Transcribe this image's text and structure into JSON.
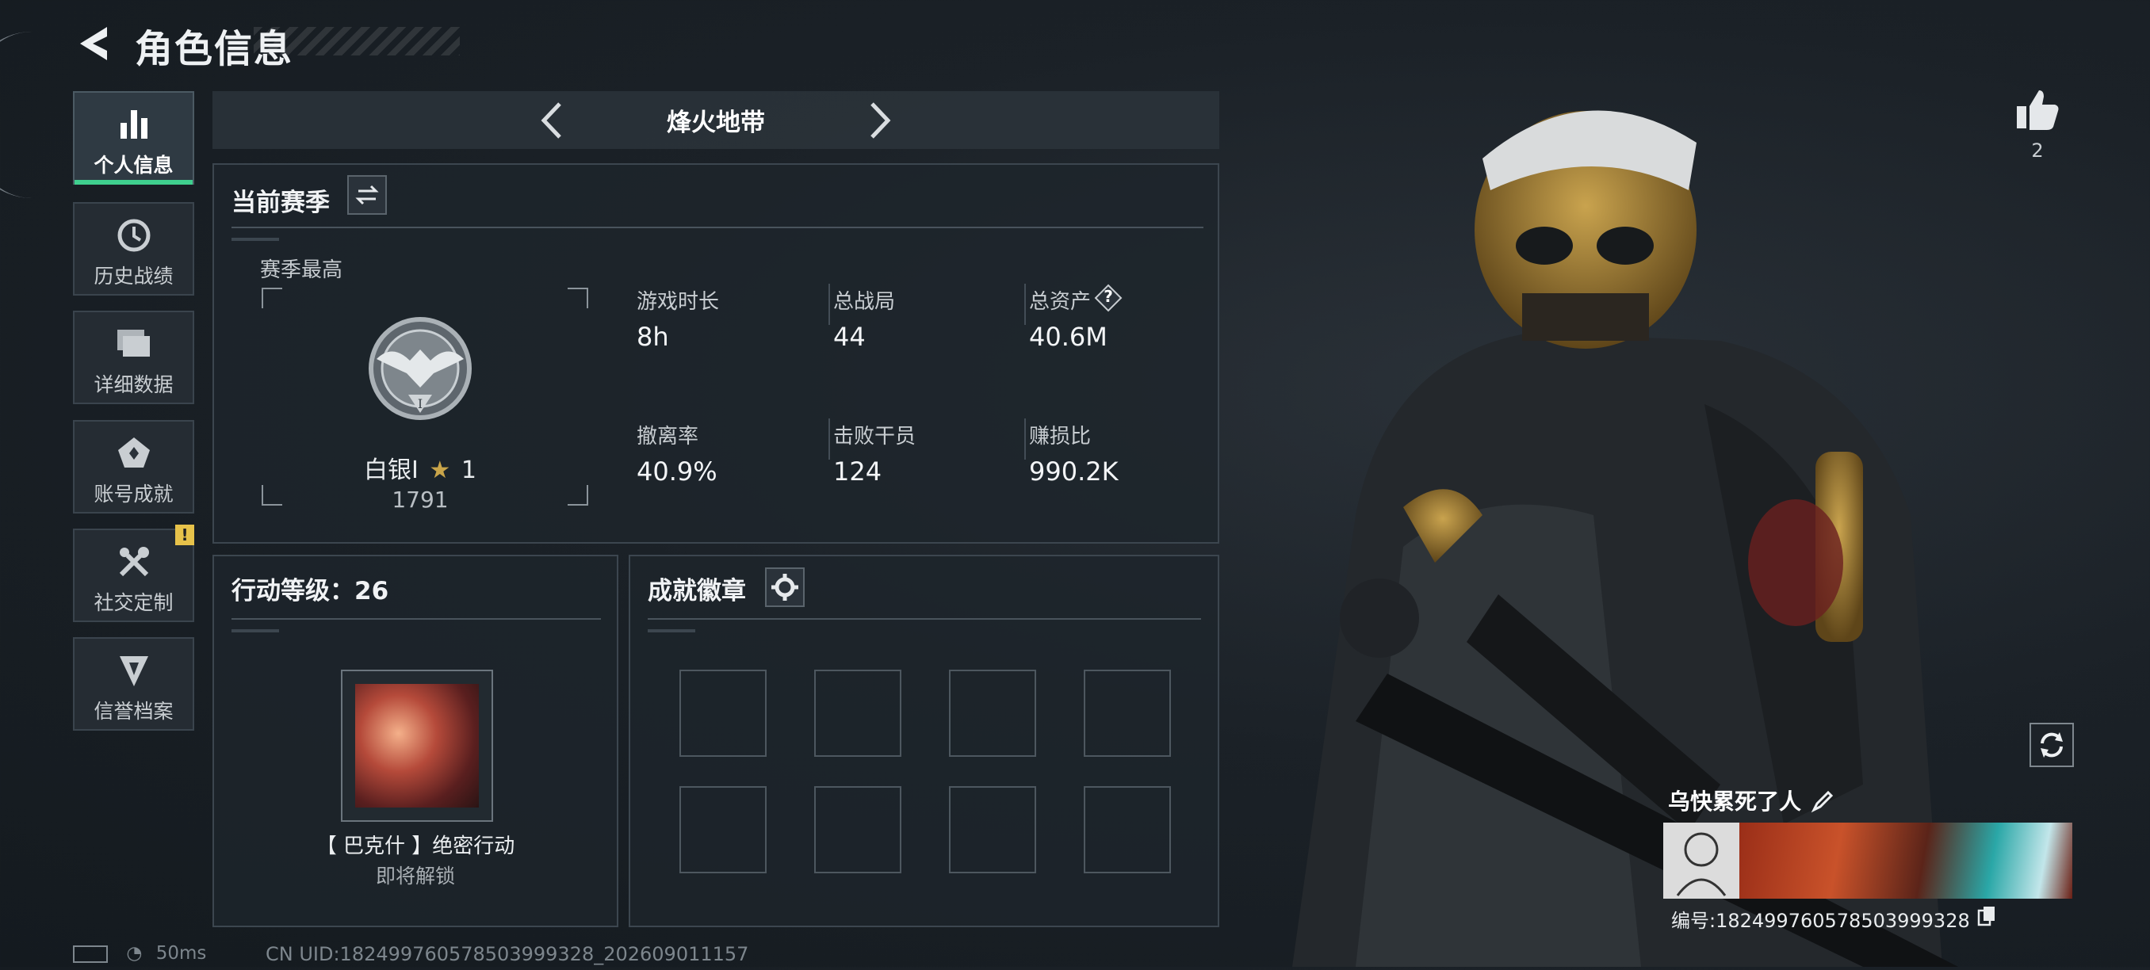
{
  "header": {
    "title": "角色信息"
  },
  "sidebar": {
    "items": [
      {
        "label": "个人信息",
        "icon": "bar-chart-icon",
        "active": true
      },
      {
        "label": "历史战绩",
        "icon": "history-icon"
      },
      {
        "label": "详细数据",
        "icon": "folder-icon"
      },
      {
        "label": "账号成就",
        "icon": "achievement-icon"
      },
      {
        "label": "社交定制",
        "icon": "tools-icon",
        "badge": "!"
      },
      {
        "label": "信誉档案",
        "icon": "credit-icon"
      }
    ]
  },
  "mode": {
    "label": "烽火地带"
  },
  "season": {
    "title": "当前赛季",
    "best_label": "赛季最高",
    "rank_name": "白银I",
    "rank_stars": "1",
    "rank_score": "1791",
    "stats": [
      {
        "label": "游戏时长",
        "value": "8h"
      },
      {
        "label": "总战局",
        "value": "44"
      },
      {
        "label": "总资产",
        "value": "40.6M"
      },
      {
        "label": "撤离率",
        "value": "40.9%"
      },
      {
        "label": "击败干员",
        "value": "124"
      },
      {
        "label": "赚损比",
        "value": "990.2K"
      }
    ],
    "help_glyph": "?"
  },
  "level": {
    "title": "行动等级：26",
    "operation_name": "【 巴克什 】绝密行动",
    "operation_status": "即将解锁"
  },
  "badges": {
    "title": "成就徽章",
    "slots": 8
  },
  "status_bar": {
    "latency": "50ms",
    "uid": "CN UID:1824997605785039993​28_202609011157"
  },
  "player": {
    "likes": "2",
    "name": "乌快累死了人",
    "id_line": "编号:182499760578503999328"
  },
  "colors": {
    "accent": "#3fcf8e",
    "badge": "#e7c24a"
  }
}
